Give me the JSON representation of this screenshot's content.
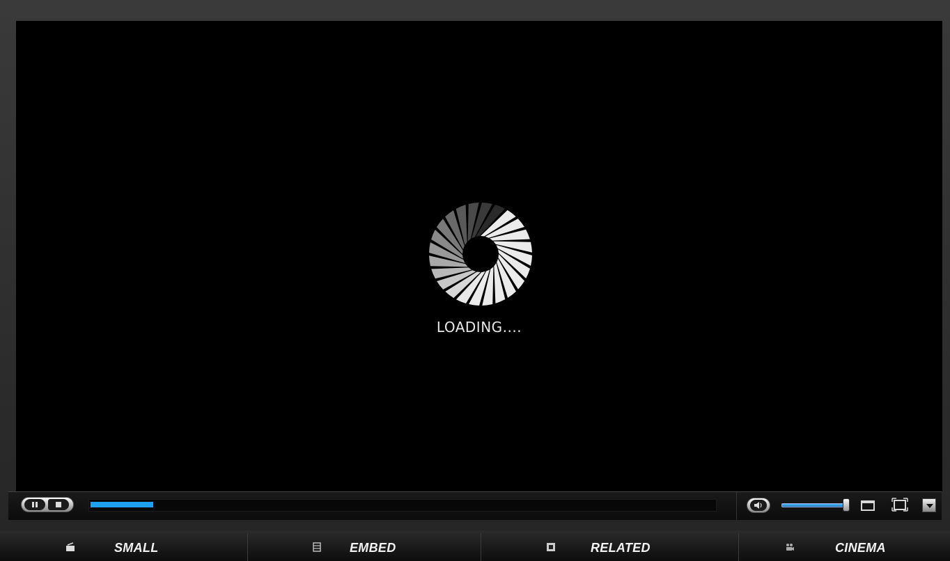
{
  "player": {
    "loading_text": "LOADING....",
    "progress": 0.1,
    "volume": 1.0,
    "accent_color": "#1ea0f0"
  },
  "icons": {
    "spinner": "loading-spinner-icon",
    "pause": "pause-icon",
    "stop": "stop-icon",
    "volume": "speaker-icon",
    "window": "window-size-icon",
    "fullscreen": "fullscreen-icon",
    "menu": "dropdown-arrow-icon"
  },
  "tabs": [
    {
      "label": "SMALL",
      "icon": "small-screen-icon"
    },
    {
      "label": "EMBED",
      "icon": "embed-icon"
    },
    {
      "label": "RELATED",
      "icon": "related-icon"
    },
    {
      "label": "CINEMA",
      "icon": "cinema-icon"
    }
  ]
}
